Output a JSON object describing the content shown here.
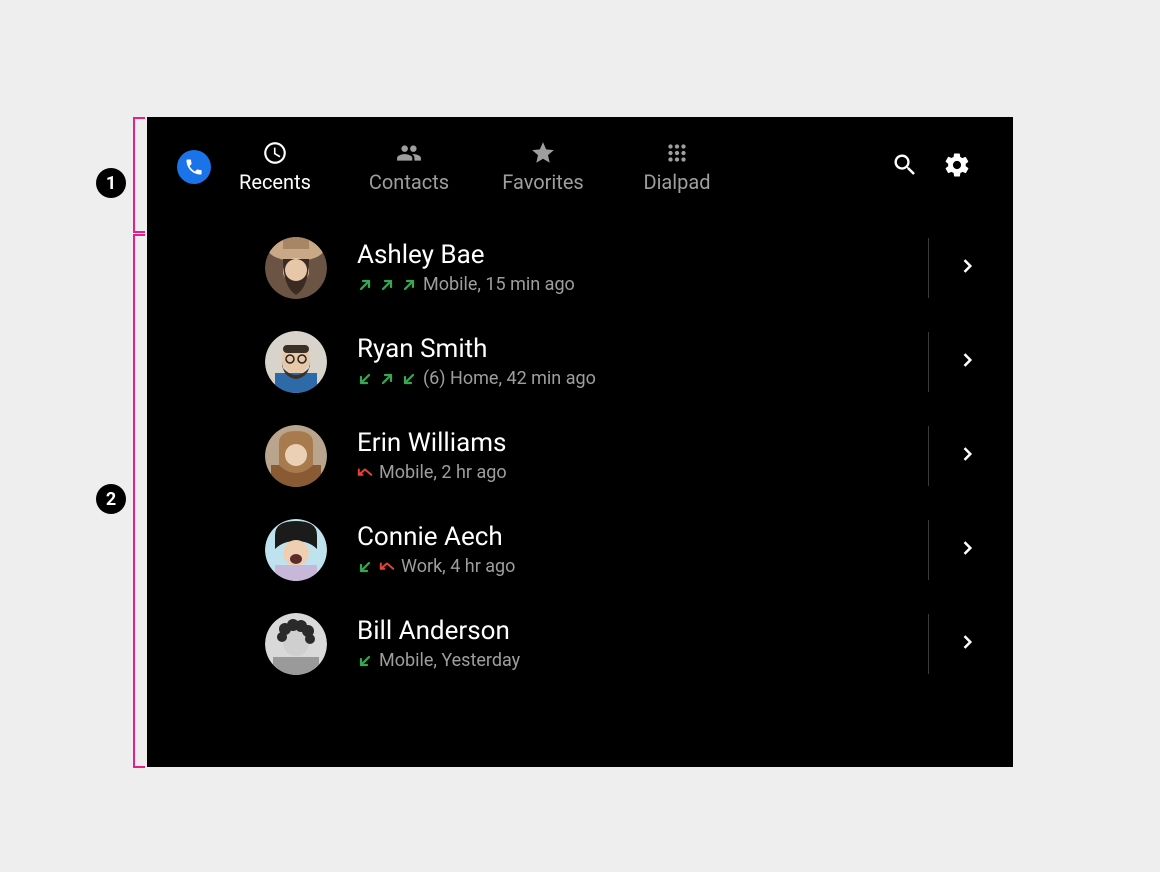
{
  "annotations": {
    "callout1": "1",
    "callout2": "2"
  },
  "tabs": {
    "recents": "Recents",
    "contacts": "Contacts",
    "favorites": "Favorites",
    "dialpad": "Dialpad"
  },
  "calls": [
    {
      "name": "Ashley Bae",
      "arrows": [
        "out",
        "out",
        "out"
      ],
      "meta_text": "Mobile, 15 min ago"
    },
    {
      "name": "Ryan Smith",
      "arrows": [
        "in",
        "out",
        "in"
      ],
      "meta_text": "(6) Home, 42 min ago"
    },
    {
      "name": "Erin Williams",
      "arrows": [
        "miss"
      ],
      "meta_text": "Mobile, 2 hr ago"
    },
    {
      "name": "Connie Aech",
      "arrows": [
        "in",
        "miss"
      ],
      "meta_text": "Work, 4 hr ago"
    },
    {
      "name": "Bill Anderson",
      "arrows": [
        "in"
      ],
      "meta_text": "Mobile, Yesterday"
    }
  ]
}
